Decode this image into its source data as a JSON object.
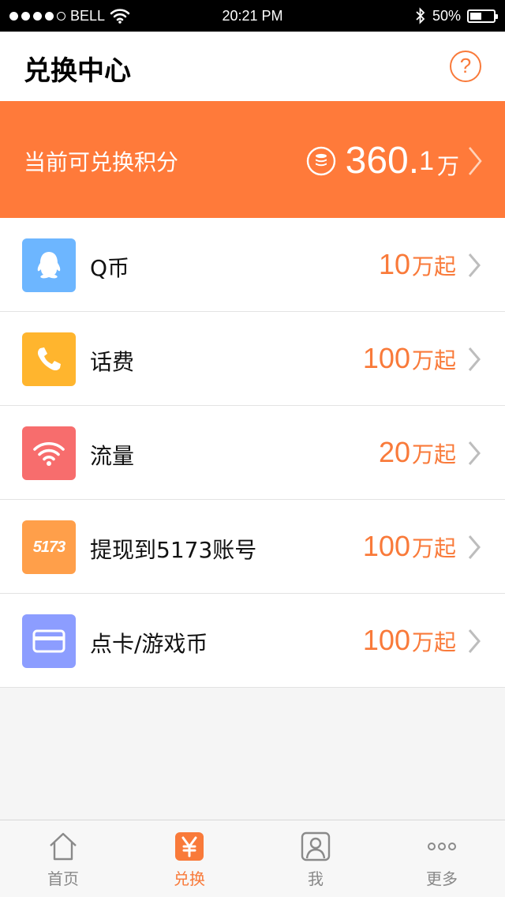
{
  "status_bar": {
    "carrier": "BELL",
    "time": "20:21  PM",
    "battery": "50%",
    "battery_level": 0.5
  },
  "header": {
    "title": "兑换中心",
    "help_label": "?"
  },
  "banner": {
    "label": "当前可兑换积分",
    "points": "360.",
    "points_decimal": "1",
    "points_unit": "万",
    "icon": "coin-stack-icon"
  },
  "exchange_items": [
    {
      "label": "Q币",
      "amount": "10",
      "unit": "万起",
      "icon": "qq-penguin-icon",
      "color": "#6db6ff"
    },
    {
      "label": "话费",
      "amount": "100",
      "unit": "万起",
      "icon": "phone-icon",
      "color": "#ffb52e"
    },
    {
      "label": "流量",
      "amount": "20",
      "unit": "万起",
      "icon": "wifi-icon",
      "color": "#f76d6d"
    },
    {
      "label": "提现到5173账号",
      "amount": "100",
      "unit": "万起",
      "icon": "5173-logo-icon",
      "icon_text": "5173",
      "color": "#ff9f4a"
    },
    {
      "label": "点卡/游戏币",
      "amount": "100",
      "unit": "万起",
      "icon": "card-icon",
      "color": "#8c9dff"
    }
  ],
  "tabs": [
    {
      "label": "首页",
      "icon": "home-icon",
      "active": false
    },
    {
      "label": "兑换",
      "icon": "yen-icon",
      "active": true
    },
    {
      "label": "我",
      "icon": "user-icon",
      "active": false
    },
    {
      "label": "更多",
      "icon": "more-icon",
      "active": false
    }
  ],
  "colors": {
    "accent": "#ff7a3a",
    "accent_text": "#f97a3a"
  }
}
